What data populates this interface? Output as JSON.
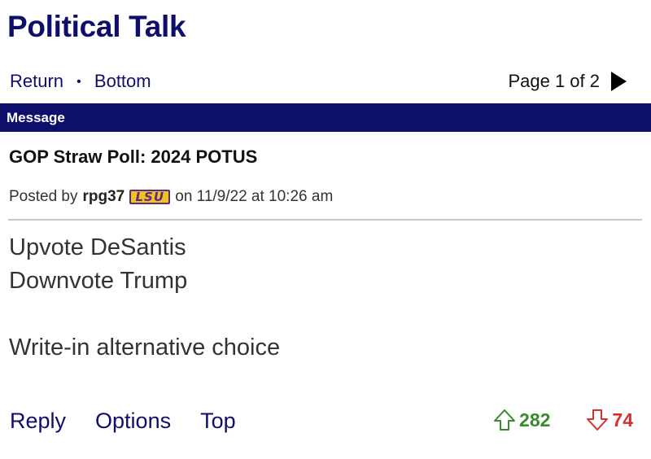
{
  "header": {
    "title": "Political Talk"
  },
  "nav": {
    "return_label": "Return",
    "separator": "•",
    "bottom_label": "Bottom"
  },
  "pager": {
    "text": "Page 1 of 2"
  },
  "message_bar": {
    "label": "Message"
  },
  "post": {
    "title": "GOP Straw Poll: 2024 POTUS",
    "posted_by_prefix": "Posted by",
    "username": "rpg37",
    "team_logo": "LSU",
    "date_text": "on 11/9/22 at 10:26 am",
    "body_lines": [
      "Upvote DeSantis",
      "Downvote Trump",
      "",
      "Write-in alternative choice"
    ]
  },
  "footer": {
    "reply_label": "Reply",
    "options_label": "Options",
    "top_label": "Top"
  },
  "votes": {
    "up_count": "282",
    "down_count": "74",
    "up_color": "#3a8a2e",
    "down_color": "#d43030"
  },
  "colors": {
    "brand_navy": "#0e0f6b"
  }
}
